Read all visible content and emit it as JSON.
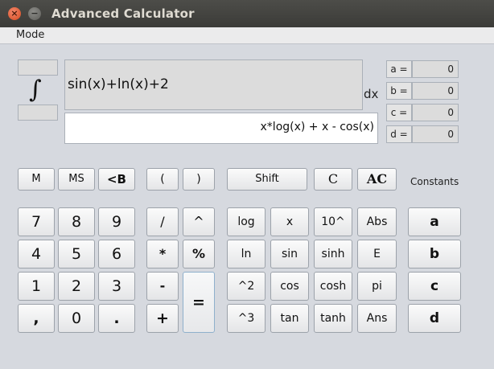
{
  "window": {
    "title": "Advanced Calculator",
    "close_glyph": "×",
    "min_glyph": "−"
  },
  "menu": {
    "mode": "Mode"
  },
  "integral": {
    "symbol": "∫",
    "upper": "",
    "lower": "",
    "dx": "dx"
  },
  "expression": "sin(x)+ln(x)+2",
  "result": "x*log(x) + x - cos(x)",
  "constants": {
    "title": "Constants",
    "items": [
      {
        "label": "a =",
        "value": "0"
      },
      {
        "label": "b =",
        "value": "0"
      },
      {
        "label": "c =",
        "value": "0"
      },
      {
        "label": "d =",
        "value": "0"
      }
    ]
  },
  "memory_row": [
    "M",
    "MS",
    "<B",
    "(",
    ")",
    "Shift",
    "C",
    "AC"
  ],
  "digits": [
    "7",
    "8",
    "9",
    "4",
    "5",
    "6",
    "1",
    "2",
    "3",
    ",",
    "0",
    "."
  ],
  "operators": [
    "/",
    "^",
    "*",
    "%",
    "-",
    "+",
    "="
  ],
  "functions": [
    "log",
    "x",
    "10^",
    "Abs",
    "ln",
    "sin",
    "sinh",
    "E",
    "^2",
    "cos",
    "cosh",
    "pi",
    "^3",
    "tan",
    "tanh",
    "Ans"
  ],
  "const_buttons": [
    "a",
    "b",
    "c",
    "d"
  ]
}
